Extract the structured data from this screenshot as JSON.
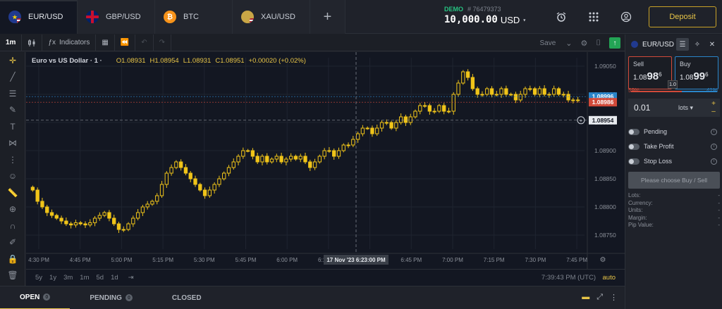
{
  "tabs": [
    {
      "label": "EUR/USD",
      "icon": "eur-usd-flag-icon",
      "active": true
    },
    {
      "label": "GBP/USD",
      "icon": "gbp-usd-flag-icon",
      "active": false
    },
    {
      "label": "BTC",
      "icon": "bitcoin-icon",
      "active": false
    },
    {
      "label": "XAU/USD",
      "icon": "gold-usd-icon",
      "active": false
    }
  ],
  "add_tab": "+",
  "account": {
    "mode": "DEMO",
    "id": "# 76479373",
    "balance": "10,000.00",
    "currency": "USD"
  },
  "top_icons": [
    "alarm-clock-icon",
    "apps-grid-icon",
    "user-profile-icon"
  ],
  "deposit_label": "Deposit",
  "chart_toolbar": {
    "interval": "1m",
    "indicators_label": "Indicators",
    "save_label": "Save"
  },
  "legend": {
    "symbol": "Euro vs US Dollar · 1 ·",
    "open": "O1.08931",
    "high": "H1.08954",
    "low": "L1.08931",
    "close": "C1.08951",
    "change": "+0.00020 (+0.02%)"
  },
  "crosshair": {
    "price_label": "1.08954",
    "time_label": "17 Nov '23   6:23:00 PM"
  },
  "price_tags": {
    "ask": "1.08996",
    "bid": "1.08986"
  },
  "timeframes": [
    "5y",
    "1y",
    "3m",
    "1m",
    "5d",
    "1d"
  ],
  "clock": "7:39:43 PM (UTC)",
  "auto_label": "auto",
  "bottom_tabs": [
    {
      "label": "OPEN",
      "count": "0",
      "active": true
    },
    {
      "label": "PENDING",
      "count": "0",
      "active": false
    },
    {
      "label": "CLOSED",
      "count": "",
      "active": false
    }
  ],
  "panel": {
    "symbol": "EUR/USD",
    "sell": {
      "label": "Sell",
      "prefix": "1.08",
      "big": "98",
      "pip": "6"
    },
    "buy": {
      "label": "Buy",
      "prefix": "1.08",
      "big": "99",
      "pip": "6"
    },
    "spread": "1.0",
    "sell_pct": "59%",
    "buy_pct": "41%",
    "sell_fraction": 0.59,
    "lots_value": "0.01",
    "lots_unit": "lots",
    "toggles": [
      "Pending",
      "Take Profit",
      "Stop Loss"
    ],
    "choose_label": "Please choose Buy / Sell",
    "info": [
      {
        "label": "Lots:",
        "value": "-"
      },
      {
        "label": "Currency:",
        "value": "-"
      },
      {
        "label": "Units:",
        "value": "-"
      },
      {
        "label": "Margin:",
        "value": "-"
      },
      {
        "label": "Pip Value:",
        "value": "-"
      }
    ]
  },
  "colors": {
    "candle": "#f0c419",
    "ask_tag": "#2a85c9",
    "bid_tag": "#d24a3a",
    "accent": "#e8c547",
    "demo": "#26c281"
  },
  "chart_data": {
    "type": "candlestick",
    "y_ticks": [
      "1.09050",
      "1.09000",
      "1.08950",
      "1.08900",
      "1.08850",
      "1.08800",
      "1.08750"
    ],
    "x_ticks": [
      "4:30 PM",
      "4:45 PM",
      "5:00 PM",
      "5:15 PM",
      "5:30 PM",
      "5:45 PM",
      "6:00 PM",
      "6:15 PM",
      "6:30 PM",
      "6:45 PM",
      "7:00 PM",
      "7:15 PM",
      "7:30 PM",
      "7:45 PM"
    ],
    "ylim": [
      1.08725,
      1.09065
    ],
    "closes": [
      1.0883,
      1.0881,
      1.088,
      1.0879,
      1.08785,
      1.0878,
      1.08775,
      1.0877,
      1.08768,
      1.08772,
      1.0877,
      1.08768,
      1.08772,
      1.0878,
      1.08785,
      1.0879,
      1.0878,
      1.0877,
      1.0876,
      1.0876,
      1.0877,
      1.0878,
      1.0879,
      1.088,
      1.08805,
      1.0881,
      1.0882,
      1.0884,
      1.0886,
      1.0887,
      1.0888,
      1.0887,
      1.0886,
      1.0885,
      1.0884,
      1.0883,
      1.0882,
      1.0883,
      1.0884,
      1.0885,
      1.0886,
      1.0887,
      1.0888,
      1.0889,
      1.089,
      1.089,
      1.0889,
      1.0888,
      1.0889,
      1.0888,
      1.08885,
      1.0889,
      1.0888,
      1.08885,
      1.0889,
      1.08885,
      1.0889,
      1.0888,
      1.0887,
      1.0888,
      1.0889,
      1.089,
      1.089,
      1.0889,
      1.089,
      1.0891,
      1.0891,
      1.0892,
      1.0893,
      1.0894,
      1.0894,
      1.0893,
      1.0894,
      1.0895,
      1.0895,
      1.0894,
      1.0895,
      1.0896,
      1.0895,
      1.0896,
      1.0897,
      1.0898,
      1.0898,
      1.0897,
      1.0897,
      1.0898,
      1.0897,
      1.0897,
      1.09,
      1.0902,
      1.0904,
      1.0903,
      1.0901,
      1.09,
      1.09,
      1.0901,
      1.09,
      1.09,
      1.0901,
      1.09,
      1.09,
      1.0899,
      1.09,
      1.0901,
      1.0901,
      1.09,
      1.0901,
      1.09,
      1.09,
      1.0901,
      1.09,
      1.09,
      1.0899,
      1.0899,
      1.0899
    ]
  }
}
